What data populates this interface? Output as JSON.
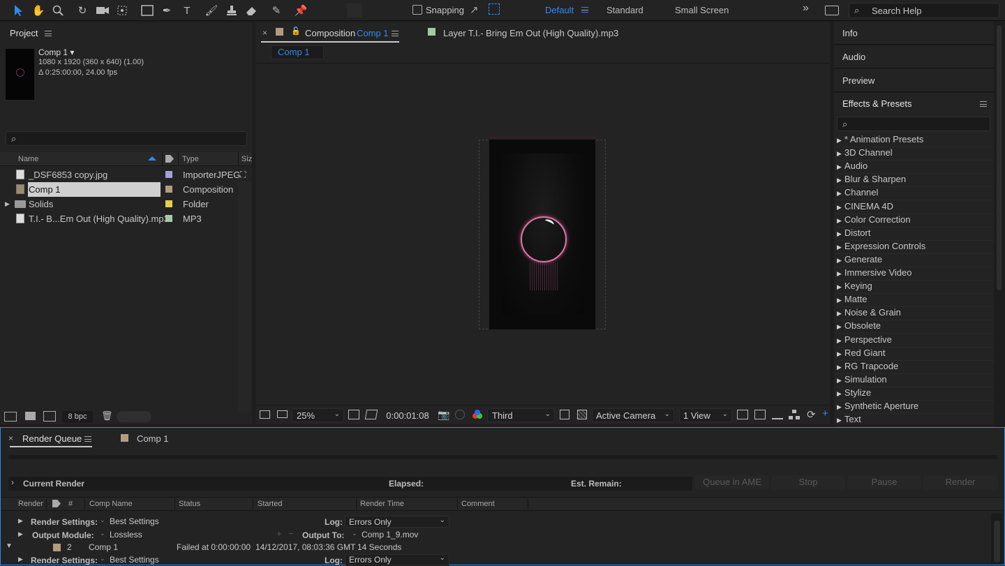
{
  "toolbar": {
    "snapping_label": "Snapping",
    "workspaces": [
      "Default",
      "Standard",
      "Small Screen"
    ],
    "search_placeholder": "Search Help",
    "accent": "#2d8ceb"
  },
  "project": {
    "title": "Project",
    "comp_name": "Comp 1 ▾",
    "comp_dims": "1080 x 1920  (360 x 640) (1.00)",
    "comp_duration": "Δ 0:25:00:00, 24.00 fps",
    "col_name": "Name",
    "col_type": "Type",
    "col_size": "Siz",
    "items": [
      {
        "name": "_DSF6853 copy.jpg",
        "type": "ImporterJPEG",
        "label_color": "#a3a2d6"
      },
      {
        "name": "Comp 1",
        "type": "Composition",
        "label_color": "#b49b80"
      },
      {
        "name": "Solids",
        "type": "Folder",
        "label_color": "#e4cf51"
      },
      {
        "name": "T.I.- B...Em Out (High Quality).mp3",
        "type": "MP3",
        "label_color": "#a6c8a6"
      }
    ],
    "bpc": "8 bpc"
  },
  "viewer": {
    "tab_prefix": "Composition",
    "tab_comp": "Comp 1",
    "layer_tab": "Layer T.I.- Bring Em Out (High Quality).mp3",
    "breadcrumb": "Comp 1",
    "zoom": "25%",
    "timecode": "0:00:01:08",
    "resolution": "Third",
    "camera": "Active Camera",
    "views": "1 View"
  },
  "side": {
    "tabs": [
      "Info",
      "Audio",
      "Preview"
    ],
    "effects_title": "Effects & Presets",
    "effects": [
      "* Animation Presets",
      "3D Channel",
      "Audio",
      "Blur & Sharpen",
      "Channel",
      "CINEMA 4D",
      "Color Correction",
      "Distort",
      "Expression Controls",
      "Generate",
      "Immersive Video",
      "Keying",
      "Matte",
      "Noise & Grain",
      "Obsolete",
      "Perspective",
      "Red Giant",
      "RG Trapcode",
      "Simulation",
      "Stylize",
      "Synthetic Aperture",
      "Text"
    ]
  },
  "render_queue": {
    "tab": "Render Queue",
    "comp_tab": "Comp 1",
    "current_render": "Current Render",
    "elapsed": "Elapsed:",
    "est_remain": "Est. Remain:",
    "buttons": [
      "Queue in AME",
      "Stop",
      "Pause",
      "Render"
    ],
    "columns": [
      "Render",
      "#",
      "Comp Name",
      "Status",
      "Started",
      "Render Time",
      "Comment"
    ],
    "render_settings_label": "Render Settings:",
    "output_module_label": "Output Module:",
    "log_label": "Log:",
    "output_to_label": "Output To:",
    "row1": {
      "render_settings": "Best Settings",
      "log": "Errors Only",
      "output_module": "Lossless",
      "output_to": "Comp 1_9.mov"
    },
    "row2": {
      "num": "2",
      "comp": "Comp 1",
      "status": "Failed at 0:00:00:00",
      "started": "14/12/2017, 08:03:36 GMT",
      "render_time": "14 Seconds",
      "render_settings": "Best Settings",
      "log": "Errors Only"
    }
  }
}
